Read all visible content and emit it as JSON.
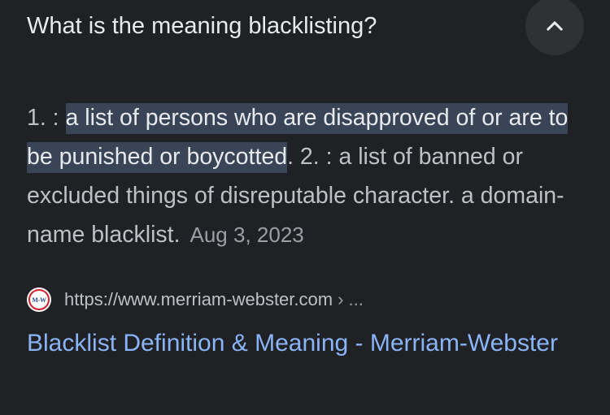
{
  "question": {
    "text": "What is the meaning blacklisting?"
  },
  "collapse_button": {
    "icon": "chevron-up-icon"
  },
  "answer": {
    "prefix": "1. : ",
    "highlighted": "a list of persons who are disapproved of or are to be punished or boycotted",
    "rest": ". 2. : a list of banned or excluded things of disreputable character. a domain-name blacklist.",
    "date": "Aug 3, 2023"
  },
  "source": {
    "favicon_text": "M-W",
    "url": "https://www.merriam-webster.com",
    "crumb": "› ..."
  },
  "result": {
    "title": "Blacklist Definition & Meaning - Merriam-Webster"
  },
  "colors": {
    "background": "#202124",
    "highlight": "#394457",
    "link": "#8ab4f8"
  }
}
